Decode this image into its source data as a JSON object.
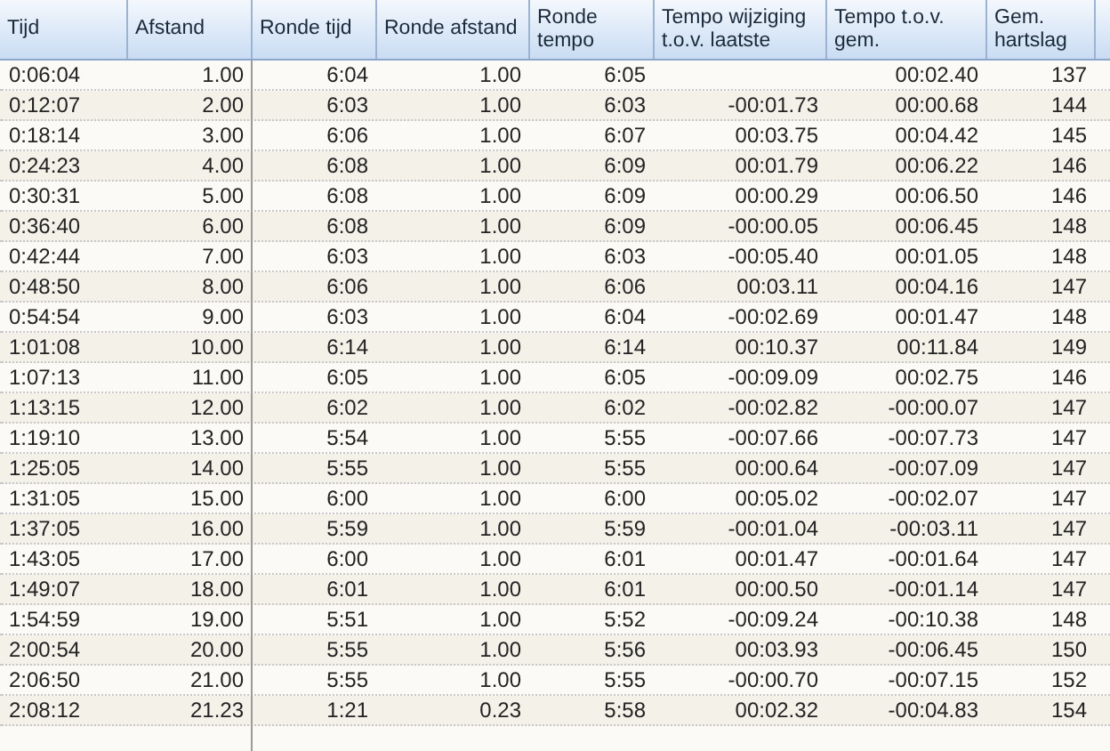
{
  "table": {
    "columns": [
      {
        "label": "Tijd"
      },
      {
        "label": "Afstand"
      },
      {
        "label": "Ronde tijd"
      },
      {
        "label": "Ronde afstand"
      },
      {
        "label": "Ronde tempo"
      },
      {
        "label": "Tempo wijziging t.o.v. laatste"
      },
      {
        "label": "Tempo t.o.v. gem."
      },
      {
        "label": "Gem. hartslag"
      }
    ],
    "rows": [
      [
        "0:06:04",
        "1.00",
        "6:04",
        "1.00",
        "6:05",
        "",
        "00:02.40",
        "137"
      ],
      [
        "0:12:07",
        "2.00",
        "6:03",
        "1.00",
        "6:03",
        "-00:01.73",
        "00:00.68",
        "144"
      ],
      [
        "0:18:14",
        "3.00",
        "6:06",
        "1.00",
        "6:07",
        "00:03.75",
        "00:04.42",
        "145"
      ],
      [
        "0:24:23",
        "4.00",
        "6:08",
        "1.00",
        "6:09",
        "00:01.79",
        "00:06.22",
        "146"
      ],
      [
        "0:30:31",
        "5.00",
        "6:08",
        "1.00",
        "6:09",
        "00:00.29",
        "00:06.50",
        "146"
      ],
      [
        "0:36:40",
        "6.00",
        "6:08",
        "1.00",
        "6:09",
        "-00:00.05",
        "00:06.45",
        "148"
      ],
      [
        "0:42:44",
        "7.00",
        "6:03",
        "1.00",
        "6:03",
        "-00:05.40",
        "00:01.05",
        "148"
      ],
      [
        "0:48:50",
        "8.00",
        "6:06",
        "1.00",
        "6:06",
        "00:03.11",
        "00:04.16",
        "147"
      ],
      [
        "0:54:54",
        "9.00",
        "6:03",
        "1.00",
        "6:04",
        "-00:02.69",
        "00:01.47",
        "148"
      ],
      [
        "1:01:08",
        "10.00",
        "6:14",
        "1.00",
        "6:14",
        "00:10.37",
        "00:11.84",
        "149"
      ],
      [
        "1:07:13",
        "11.00",
        "6:05",
        "1.00",
        "6:05",
        "-00:09.09",
        "00:02.75",
        "146"
      ],
      [
        "1:13:15",
        "12.00",
        "6:02",
        "1.00",
        "6:02",
        "-00:02.82",
        "-00:00.07",
        "147"
      ],
      [
        "1:19:10",
        "13.00",
        "5:54",
        "1.00",
        "5:55",
        "-00:07.66",
        "-00:07.73",
        "147"
      ],
      [
        "1:25:05",
        "14.00",
        "5:55",
        "1.00",
        "5:55",
        "00:00.64",
        "-00:07.09",
        "147"
      ],
      [
        "1:31:05",
        "15.00",
        "6:00",
        "1.00",
        "6:00",
        "00:05.02",
        "-00:02.07",
        "147"
      ],
      [
        "1:37:05",
        "16.00",
        "5:59",
        "1.00",
        "5:59",
        "-00:01.04",
        "-00:03.11",
        "147"
      ],
      [
        "1:43:05",
        "17.00",
        "6:00",
        "1.00",
        "6:01",
        "00:01.47",
        "-00:01.64",
        "147"
      ],
      [
        "1:49:07",
        "18.00",
        "6:01",
        "1.00",
        "6:01",
        "00:00.50",
        "-00:01.14",
        "147"
      ],
      [
        "1:54:59",
        "19.00",
        "5:51",
        "1.00",
        "5:52",
        "-00:09.24",
        "-00:10.38",
        "148"
      ],
      [
        "2:00:54",
        "20.00",
        "5:55",
        "1.00",
        "5:56",
        "00:03.93",
        "-00:06.45",
        "150"
      ],
      [
        "2:06:50",
        "21.00",
        "5:55",
        "1.00",
        "5:55",
        "-00:00.70",
        "-00:07.15",
        "152"
      ],
      [
        "2:08:12",
        "21.23",
        "1:21",
        "0.23",
        "5:58",
        "00:02.32",
        "-00:04.83",
        "154"
      ]
    ]
  }
}
